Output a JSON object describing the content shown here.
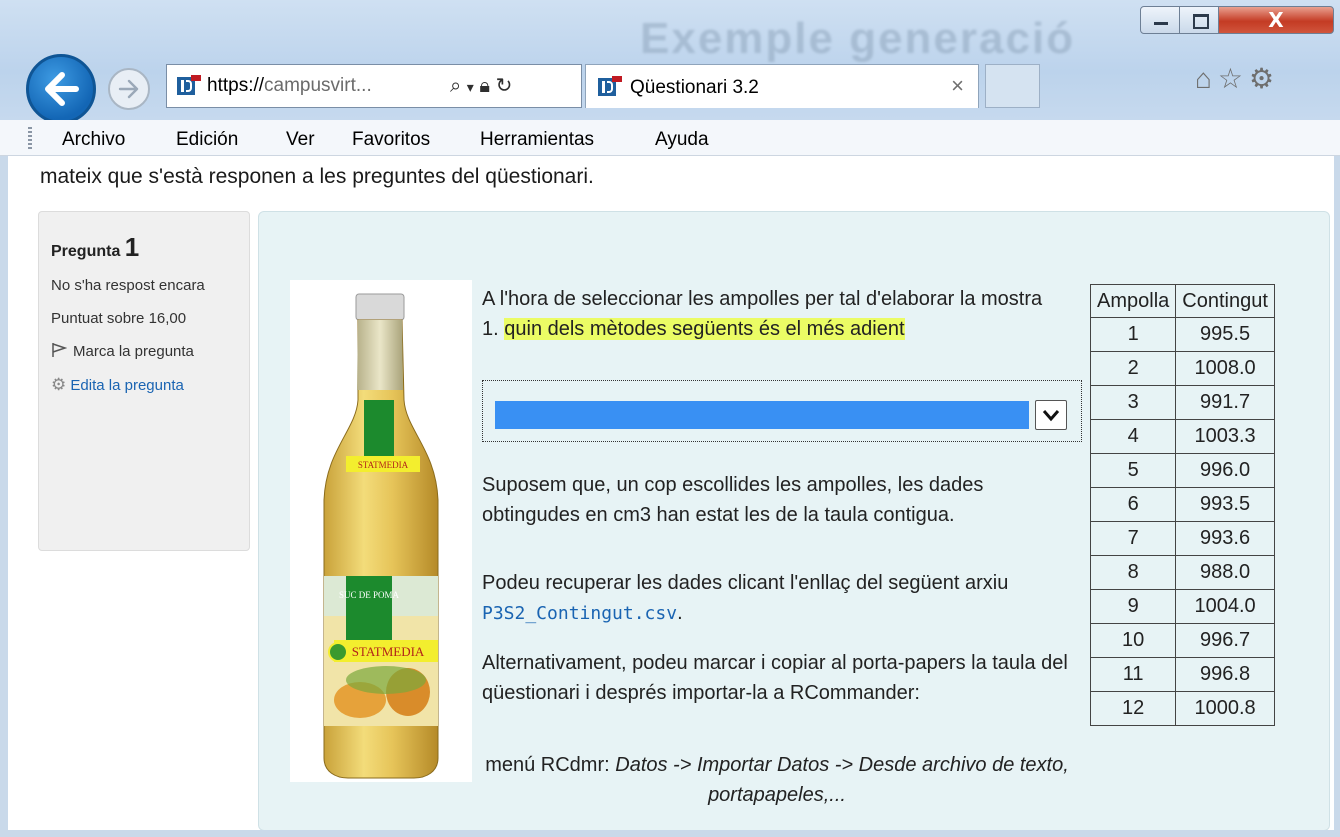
{
  "window": {
    "ghost_title": "Exemple generació",
    "close_label": "X"
  },
  "address_bar": {
    "url_prefix": "https://",
    "url_rest": "campusvirt...",
    "icons": [
      "search-icon",
      "dropdown-icon",
      "lock-icon",
      "refresh-icon"
    ]
  },
  "tab": {
    "title": "Qüestionari 3.2",
    "close": "×"
  },
  "menu": [
    "Archivo",
    "Edición",
    "Ver",
    "Favoritos",
    "Herramientas",
    "Ayuda"
  ],
  "page": {
    "intro": "mateix que s'està responen a les preguntes del qüestionari.",
    "qinfo": {
      "label": "Pregunta",
      "number": "1",
      "status": "No s'ha respost encara",
      "score": "Puntuat sobre 16,00",
      "flag": "Marca la pregunta",
      "edit": "Edita la pregunta"
    },
    "question": {
      "line1": "A l'hora de seleccionar les ampolles per tal d'elaborar la mostra",
      "item_no": "1.",
      "item_text": "quin dels mètodes següents és el més adient",
      "select_value": "",
      "p1": "Suposem que, un cop escollides les ampolles, les dades obtingudes en cm3 han estat les de la taula contigua.",
      "p2_text": "Podeu recuperar les dades clicant l'enllaç del següent arxiu",
      "p2_link": "P3S2_Contingut.csv",
      "p2_end": ".",
      "p3": "Alternativament, podeu marcar i copiar al porta-papers la taula del qüestionari i després importar-la a RCommander:",
      "menu_prefix": "menú RCdmr:",
      "menu_path": "Datos -> Importar Datos -> Desde archivo de texto, portapapeles,..."
    },
    "bottle": {
      "label_top": "SUC DE POMA",
      "brand": "STATMEDIA"
    },
    "table": {
      "headers": [
        "Ampolla",
        "Contingut"
      ],
      "rows": [
        [
          "1",
          "995.5"
        ],
        [
          "2",
          "1008.0"
        ],
        [
          "3",
          "991.7"
        ],
        [
          "4",
          "1003.3"
        ],
        [
          "5",
          "996.0"
        ],
        [
          "6",
          "993.5"
        ],
        [
          "7",
          "993.6"
        ],
        [
          "8",
          "988.0"
        ],
        [
          "9",
          "1004.0"
        ],
        [
          "10",
          "996.7"
        ],
        [
          "11",
          "996.8"
        ],
        [
          "12",
          "1000.8"
        ]
      ]
    }
  }
}
